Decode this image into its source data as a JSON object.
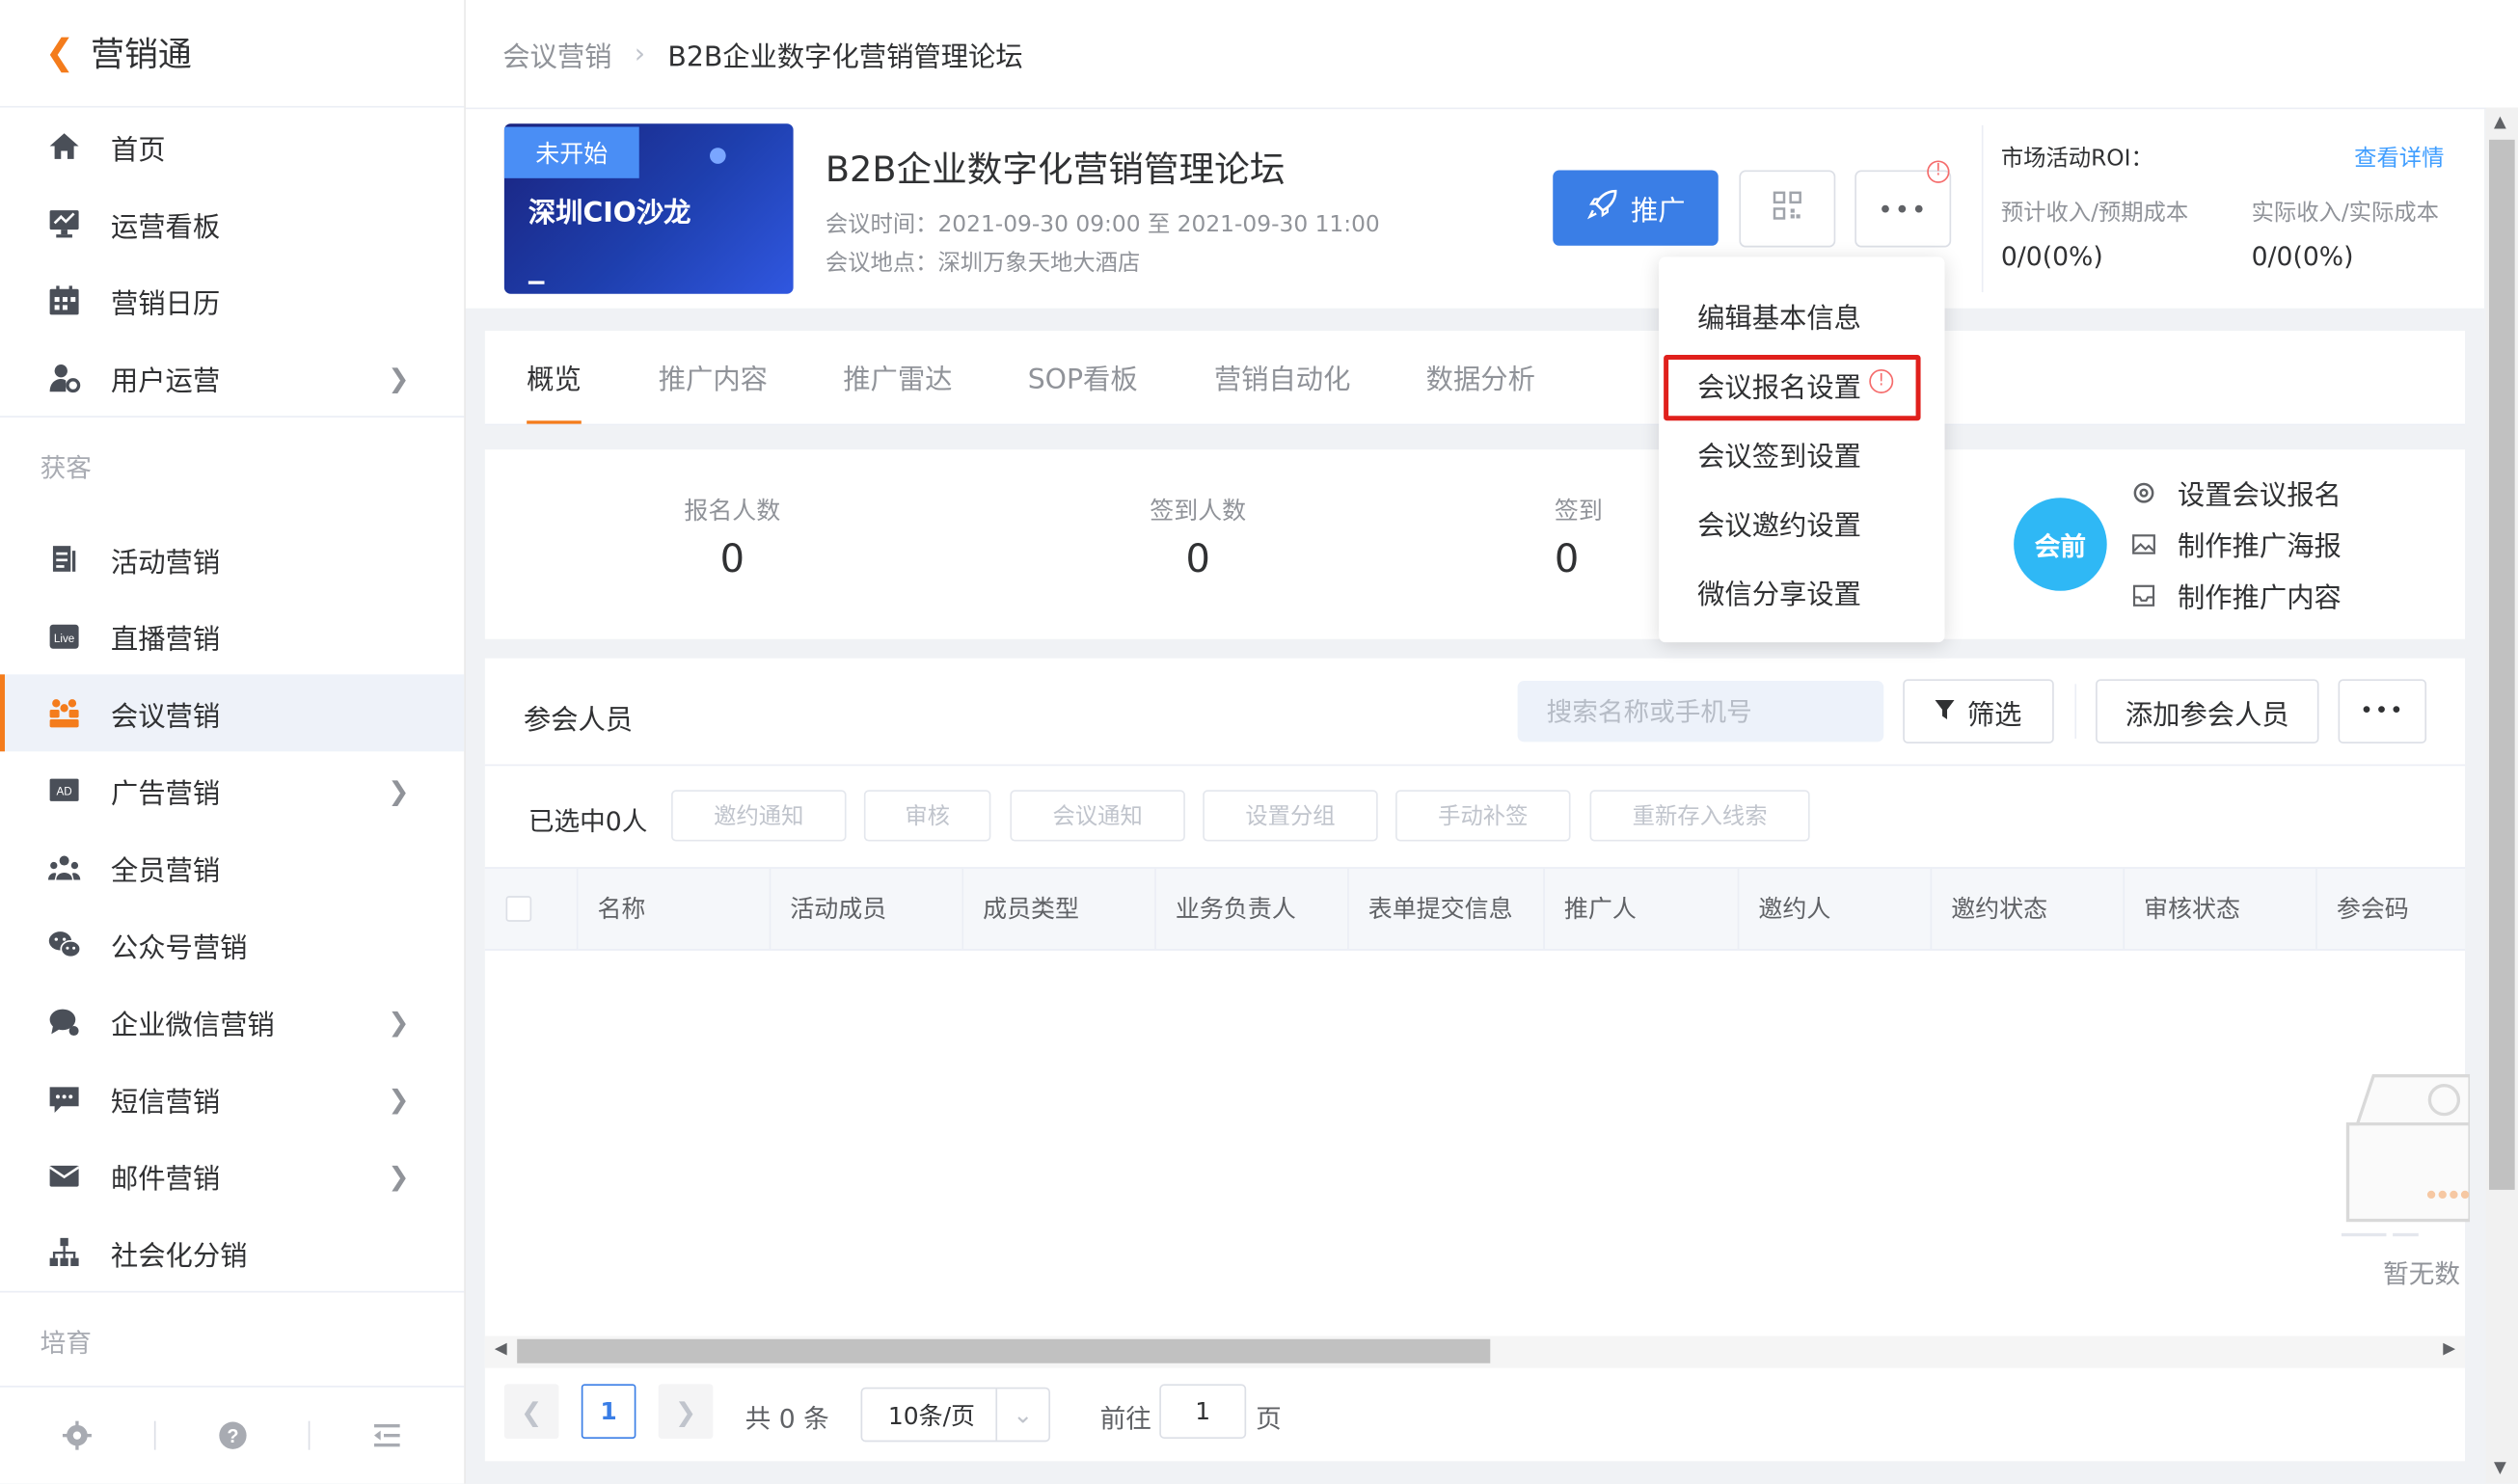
{
  "app": {
    "title": "营销通"
  },
  "sidebar": {
    "items": [
      {
        "label": "首页",
        "icon": "home-icon"
      },
      {
        "label": "运营看板",
        "icon": "dashboard-icon"
      },
      {
        "label": "营销日历",
        "icon": "calendar-icon"
      },
      {
        "label": "用户运营",
        "icon": "user-settings-icon"
      }
    ],
    "group_acquire": "获客",
    "acquire_items": [
      {
        "label": "活动营销",
        "icon": "document-icon"
      },
      {
        "label": "直播营销",
        "icon": "live-icon"
      },
      {
        "label": "会议营销",
        "icon": "meeting-icon",
        "active": true
      },
      {
        "label": "广告营销",
        "icon": "ad-icon"
      },
      {
        "label": "全员营销",
        "icon": "team-icon"
      },
      {
        "label": "公众号营销",
        "icon": "wechat-icon"
      },
      {
        "label": "企业微信营销",
        "icon": "chat-icon"
      },
      {
        "label": "短信营销",
        "icon": "sms-icon"
      },
      {
        "label": "邮件营销",
        "icon": "mail-icon"
      },
      {
        "label": "社会化分销",
        "icon": "org-chart-icon"
      }
    ],
    "group_nurture": "培育"
  },
  "breadcrumb": {
    "parent": "会议营销",
    "current": "B2B企业数字化营销管理论坛"
  },
  "event": {
    "status_tag": "未开始",
    "cover_title": "深圳CIO沙龙",
    "title": "B2B企业数字化营销管理论坛",
    "time": "会议时间：2021-09-30 09:00 至 2021-09-30 11:00",
    "location": "会议地点：深圳万象天地大酒店",
    "promote_label": "推广"
  },
  "roi": {
    "title": "市场活动ROI：",
    "link": "查看详情",
    "expected_label": "预计收入/预期成本",
    "expected_value": "0/0(0%)",
    "actual_label": "实际收入/实际成本",
    "actual_value": "0/0(0%)"
  },
  "tabs": [
    "概览",
    "推广内容",
    "推广雷达",
    "SOP看板",
    "营销自动化",
    "数据分析"
  ],
  "stats": [
    {
      "label": "报名人数",
      "value": "0"
    },
    {
      "label": "签到人数",
      "value": "0"
    },
    {
      "label": "签到",
      "value": "0"
    }
  ],
  "stage": {
    "badge": "会前",
    "actions": [
      "设置会议报名",
      "制作推广海报",
      "制作推广内容"
    ]
  },
  "attendees": {
    "title": "参会人员",
    "search_placeholder": "搜索名称或手机号",
    "filter_label": "筛选",
    "add_label": "添加参会人员",
    "selected_text": "已选中0人",
    "bulk_actions": [
      "邀约通知",
      "审核",
      "会议通知",
      "设置分组",
      "手动补签",
      "重新存入线索"
    ],
    "columns": [
      "名称",
      "活动成员",
      "成员类型",
      "业务负责人",
      "表单提交信息",
      "推广人",
      "邀约人",
      "邀约状态",
      "审核状态",
      "参会码"
    ],
    "empty_text": "暂无数"
  },
  "pagination": {
    "current_page": "1",
    "total_text": "共 0 条",
    "page_size": "10条/页",
    "goto_label": "前往",
    "goto_value": "1",
    "page_unit": "页"
  },
  "dropdown": {
    "items": [
      "编辑基本信息",
      "会议报名设置",
      "会议签到设置",
      "会议邀约设置",
      "微信分享设置"
    ],
    "highlighted": "会议报名设置"
  },
  "colors": {
    "accent": "#f47c1c",
    "primary": "#3a7ee6",
    "highlight_border": "#e0201c",
    "stage_badge": "#2fb8f5"
  }
}
